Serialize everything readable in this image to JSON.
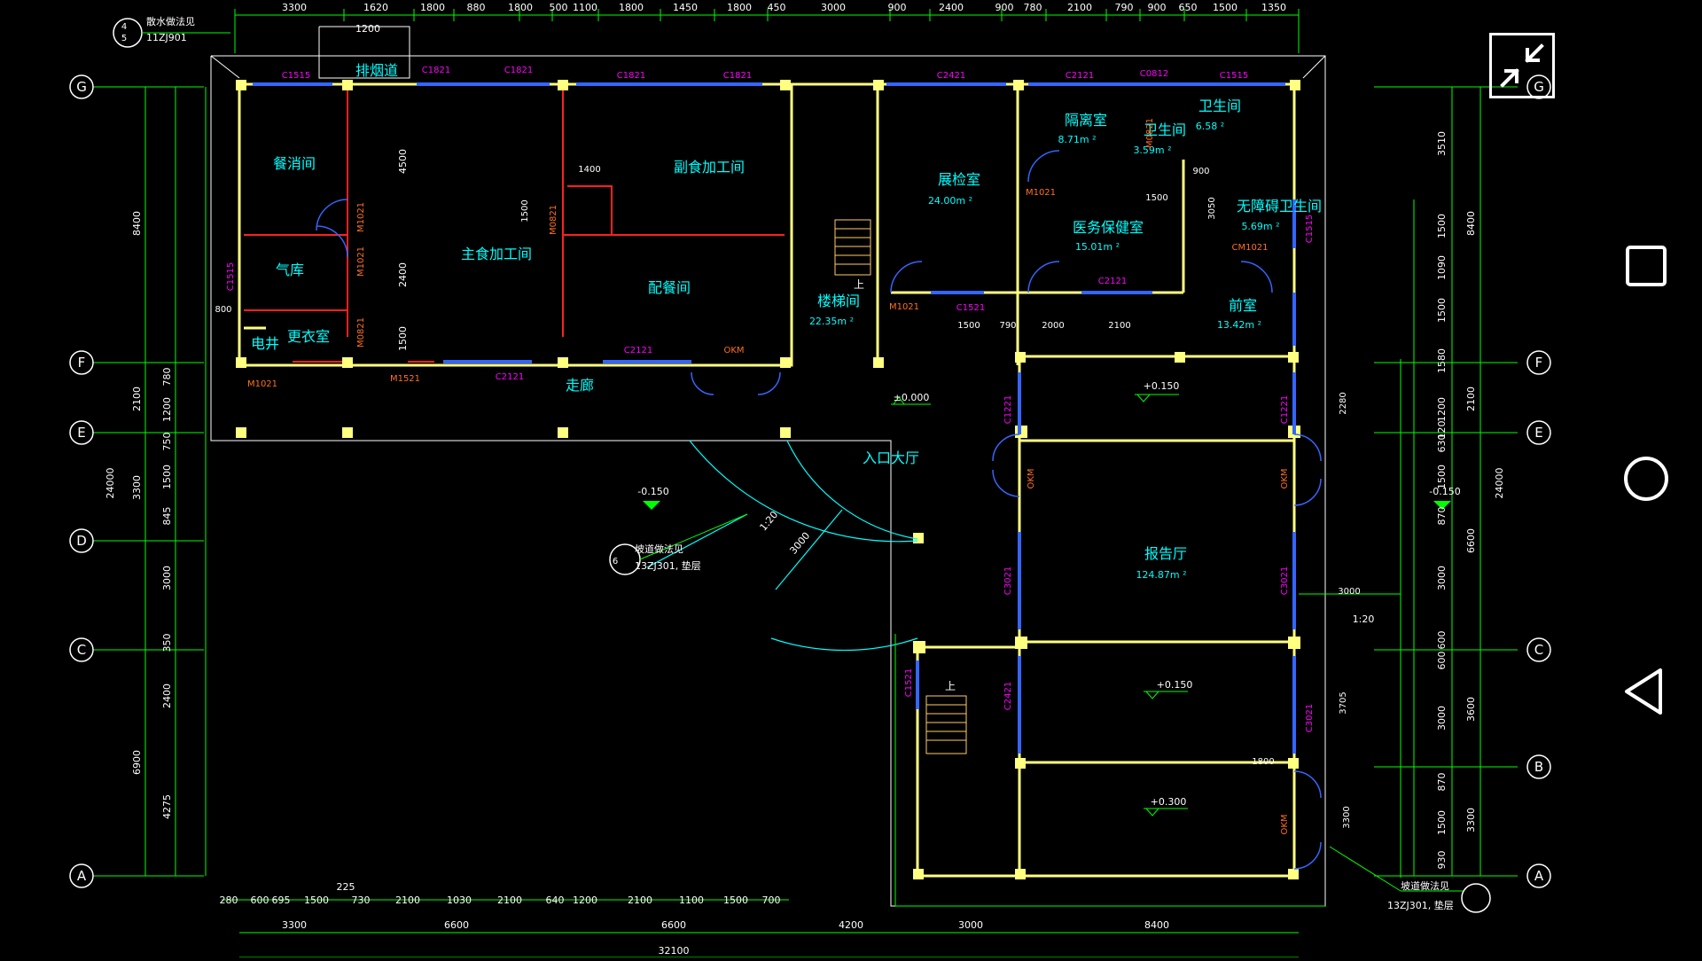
{
  "colors": {
    "wall": "#ffff80",
    "dim": "#00ff00",
    "text": "#00ffff",
    "win": "#ff00ff",
    "door": "#3366ff",
    "red": "#ff2020",
    "axis": "#ffffff"
  },
  "top_dims": [
    "3300",
    "1620",
    "1200",
    "1800",
    "880",
    "1800",
    "500",
    "1100",
    "1800",
    "1450",
    "1800",
    "450",
    "3000",
    "900",
    "2400",
    "900",
    "780",
    "2100",
    "790",
    "900",
    "650",
    "1500",
    "1350"
  ],
  "bottom_dims_row1": [
    "280",
    "600",
    "695",
    "1500",
    "730",
    "2100",
    "1030",
    "2100",
    "640",
    "1200",
    "2100",
    "1100",
    "1500",
    "700"
  ],
  "bottom_dim_extra": "225",
  "bottom_dims_row2": [
    "3300",
    "6600",
    "6600",
    "4200",
    "3000",
    "8400"
  ],
  "bottom_total": "32100",
  "left_dims_outer": [
    "8400",
    "2100",
    "24000",
    "3300",
    "6900"
  ],
  "left_dims_inner": [
    "4500",
    "2400",
    "1500",
    "780",
    "1200",
    "750",
    "1500",
    "845",
    "3000",
    "350",
    "2400",
    "4275"
  ],
  "right_dims_inner": [
    "3510",
    "1500",
    "1090",
    "1500",
    "1580",
    "1200",
    "120",
    "630",
    "1500",
    "870",
    "3000",
    "600",
    "600",
    "3000",
    "870",
    "1500",
    "930"
  ],
  "right_dims_outer": [
    "8400",
    "2100",
    "24000",
    "6600",
    "3600",
    "3300"
  ],
  "axes_left": [
    "G",
    "F",
    "E",
    "D",
    "C",
    "A"
  ],
  "axes_right": [
    "G",
    "F",
    "E",
    "C",
    "B",
    "A"
  ],
  "rooms": {
    "canxiao": "餐消间",
    "qiku": "气库",
    "dianjing": "电井",
    "gengyi": "更衣室",
    "paiyandao": "排烟道",
    "zhushi": "主食加工间",
    "fushi": "副食加工间",
    "peican": "配餐间",
    "zoulang": "走廊",
    "zhanjian": "展检室",
    "zhanjian_area": "24.00m ²",
    "louti": "楼梯间",
    "louti_area": "22.35m ²",
    "geli": "隔离室",
    "geli_area": "8.71m ²",
    "weisheng1": "卫生间",
    "weisheng1_area": "3.59m ²",
    "weisheng2": "卫生间",
    "weisheng2_area": "6.58 ²",
    "yiwu": "医务保健室",
    "yiwu_area": "15.01m ²",
    "wuzhangai": "无障碍卫生间",
    "wuzhangai_area": "5.69m ²",
    "qianshi": "前室",
    "qianshi_area": "13.42m ²",
    "rukou": "入口大厅",
    "baogao": "报告厅",
    "baogao_area": "124.87m ²"
  },
  "windows": [
    "C1515",
    "C1821",
    "C1821",
    "C1821",
    "C1821",
    "C2421",
    "C2121",
    "C0812",
    "C1515",
    "C1515",
    "C1515",
    "C1521",
    "C2121",
    "C2121",
    "C1221",
    "C1221",
    "C3021",
    "C3021",
    "C2421",
    "C1521",
    "C3021",
    "C2121"
  ],
  "doors": [
    "M1021",
    "M1021",
    "M0821",
    "M0821",
    "M1521",
    "M1021",
    "M1021",
    "M1021",
    "M0821",
    "CM1021",
    "OKM",
    "OKM",
    "OKM",
    "OKM"
  ],
  "levels": [
    "±0.000",
    "+0.150",
    "-0.150",
    "+0.150",
    "+0.300",
    "-0.150"
  ],
  "slope": "1:20",
  "slope2": "1:20",
  "ramp_dim": "3000",
  "notes": {
    "n1_title": "散水做法见",
    "n1_ref": "11ZJ901",
    "n1_num": "4",
    "n1_sub": "5",
    "n2_title": "坡道做法见",
    "n2_ref": "13ZJ301, 垫层",
    "n2_num": "6",
    "n3_title": "坡道做法见",
    "n3_ref": "13ZJ301, 垫层"
  },
  "misc_dims": [
    "1400",
    "1500",
    "1500",
    "790",
    "2000",
    "2100",
    "900",
    "1500",
    "3050",
    "800",
    "2280",
    "3000",
    "3705",
    "1800",
    "3300"
  ],
  "stair_up": "上",
  "icons": {
    "exit_fullscreen": "exit-fullscreen-icon",
    "square": "recent-apps-icon",
    "circle": "home-icon",
    "back": "back-icon"
  }
}
